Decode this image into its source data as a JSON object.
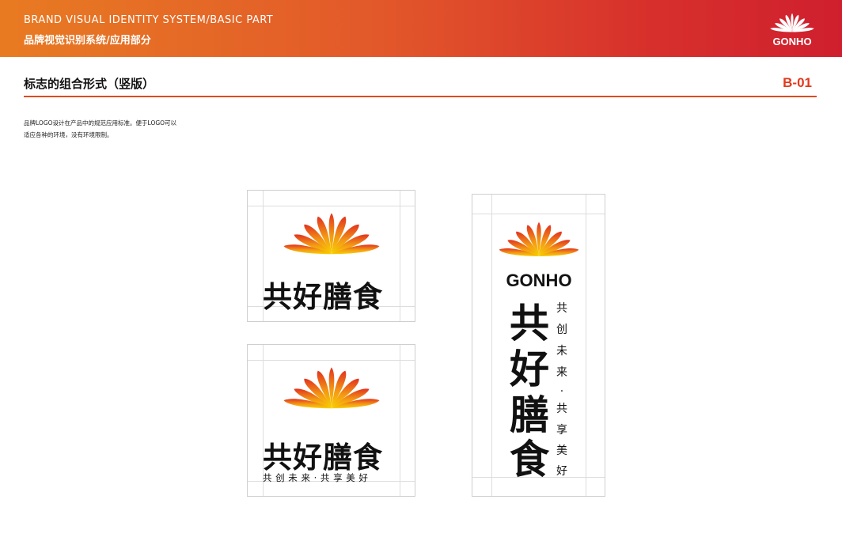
{
  "header": {
    "title_en": "BRAND VISUAL IDENTITY SYSTEM/BASIC PART",
    "title_cn": "品牌视觉识别系统/应用部分",
    "logo_text": "GONHO"
  },
  "section": {
    "title": "标志的组合形式（竖版）",
    "code": "B-01"
  },
  "description": {
    "line1": "品牌LOGO设计在产品中的规范应用标准。便于LOGO可以",
    "line2": "适应各种的环境，没有环境限制。"
  },
  "logos": {
    "horizontal": {
      "name": "共好膳食"
    },
    "horizontal_slogan": {
      "name": "共好膳食",
      "slogan": "共 创 未 来 · 共 享 美 好"
    },
    "vertical": {
      "brand": "GONHO",
      "name_chars": [
        "共",
        "好",
        "膳",
        "食"
      ],
      "slogan_chars": [
        "共",
        "创",
        "未",
        "来",
        "·",
        "共",
        "享",
        "美",
        "好"
      ]
    }
  },
  "colors": {
    "accent": "#e04a1e",
    "petal_base": "#f5c400",
    "petal_tip": "#e5321f"
  }
}
